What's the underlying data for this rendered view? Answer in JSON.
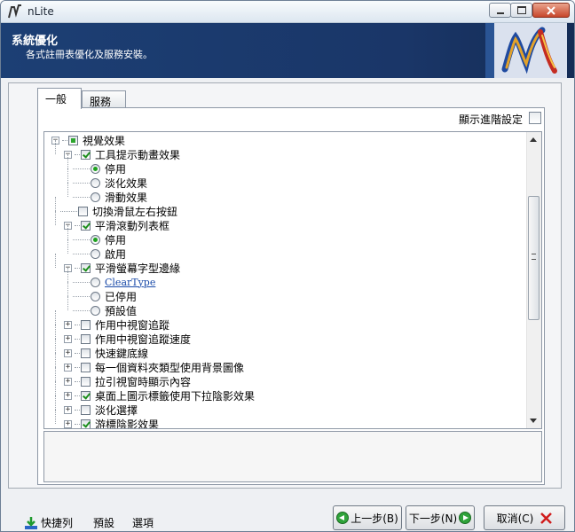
{
  "window": {
    "title": "nLite"
  },
  "header": {
    "title": "系統優化",
    "subtitle": "各式註冊表優化及服務安裝。"
  },
  "tabs": [
    {
      "label": "一般",
      "active": true
    },
    {
      "label": "服務",
      "active": false
    }
  ],
  "advanced": {
    "label": "顯示進階設定",
    "checked": false
  },
  "tree": {
    "nodes": [
      {
        "label": "視覺效果",
        "type": "checkbox",
        "state": "partial",
        "expander": "−"
      },
      {
        "label": "工具提示動畫效果",
        "type": "checkbox",
        "state": "checked",
        "expander": "−"
      },
      {
        "label": "停用",
        "type": "radio",
        "state": "checked"
      },
      {
        "label": "淡化效果",
        "type": "radio",
        "state": "unchecked"
      },
      {
        "label": "滑動效果",
        "type": "radio",
        "state": "unchecked"
      },
      {
        "label": "切換滑鼠左右按鈕",
        "type": "checkbox",
        "state": "unchecked"
      },
      {
        "label": "平滑滾動列表框",
        "type": "checkbox",
        "state": "checked",
        "expander": "−"
      },
      {
        "label": "停用",
        "type": "radio",
        "state": "checked"
      },
      {
        "label": "啟用",
        "type": "radio",
        "state": "unchecked"
      },
      {
        "label": "平滑螢幕字型邊緣",
        "type": "checkbox",
        "state": "checked",
        "expander": "−"
      },
      {
        "label": "ClearType",
        "type": "radio",
        "state": "unchecked",
        "link": true
      },
      {
        "label": "已停用",
        "type": "radio",
        "state": "unchecked"
      },
      {
        "label": "預設值",
        "type": "radio",
        "state": "unchecked"
      },
      {
        "label": "作用中視窗追蹤",
        "type": "checkbox",
        "state": "unchecked",
        "expander": "+"
      },
      {
        "label": "作用中視窗追蹤速度",
        "type": "checkbox",
        "state": "unchecked",
        "expander": "+"
      },
      {
        "label": "快速鍵底線",
        "type": "checkbox",
        "state": "unchecked",
        "expander": "+"
      },
      {
        "label": "每一個資料夾類型使用背景圖像",
        "type": "checkbox",
        "state": "unchecked",
        "expander": "+"
      },
      {
        "label": "拉引視窗時顯示內容",
        "type": "checkbox",
        "state": "unchecked",
        "expander": "+"
      },
      {
        "label": "桌面上圖示標籤使用下拉陰影效果",
        "type": "checkbox",
        "state": "checked",
        "expander": "+"
      },
      {
        "label": "淡化選擇",
        "type": "checkbox",
        "state": "unchecked",
        "expander": "+"
      },
      {
        "label": "游標陰影效果",
        "type": "checkbox",
        "state": "checked",
        "expander": "+"
      }
    ]
  },
  "footer": {
    "shortcuts": "快捷列",
    "presets": "預設",
    "options": "選項",
    "back": "上一步(B)",
    "next": "下一步(N)",
    "cancel": "取消(C)"
  },
  "colors": {
    "banner": "#1c3f74",
    "accent_green": "#2da52d",
    "cancel_red": "#d01c1c"
  }
}
